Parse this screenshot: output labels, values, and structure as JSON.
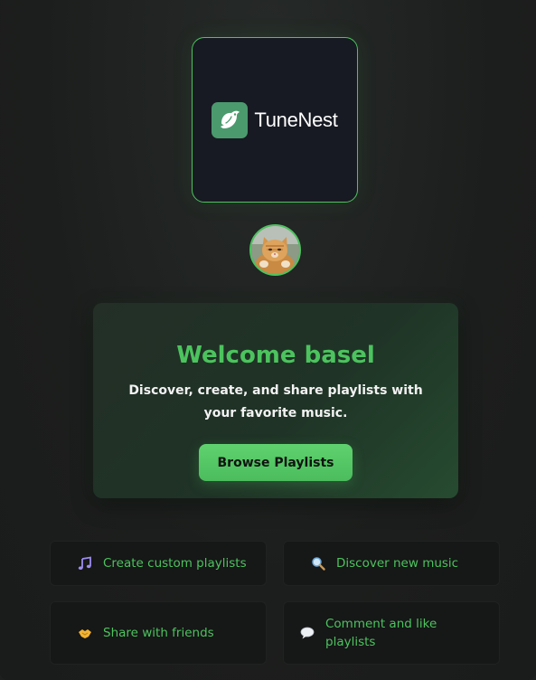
{
  "brand": {
    "name": "TuneNest"
  },
  "welcome": {
    "title": "Welcome basel",
    "description": "Discover, create, and share playlists with your favorite music.",
    "button_label": "Browse Playlists"
  },
  "features": [
    {
      "label": "Create custom playlists",
      "icon": "music-note-icon"
    },
    {
      "label": "Discover new music",
      "icon": "magnifier-icon"
    },
    {
      "label": "Share with friends",
      "icon": "handshake-icon"
    },
    {
      "label": "Comment and like playlists",
      "icon": "speech-bubble-icon"
    }
  ],
  "colors": {
    "accent": "#4cc35e",
    "background": "#1c1e1d",
    "logo_background": "#171a22",
    "card_background": "#161717"
  }
}
